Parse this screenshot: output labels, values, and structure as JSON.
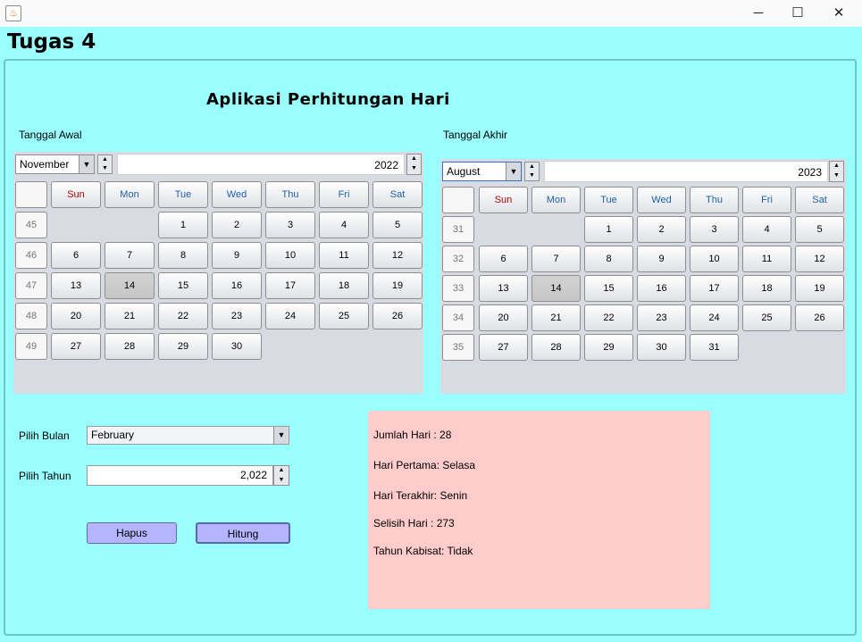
{
  "window": {
    "title_icon": "java-icon",
    "controls": {
      "minimize": "─",
      "maximize": "☐",
      "close": "✕"
    }
  },
  "frame_title": "Tugas 4",
  "app_heading": "Aplikasi Perhitungan Hari",
  "calendar_start": {
    "label": "Tanggal Awal",
    "month": "November",
    "year": "2022",
    "weekdays": [
      "Sun",
      "Mon",
      "Tue",
      "Wed",
      "Thu",
      "Fri",
      "Sat"
    ],
    "weeks": [
      "45",
      "46",
      "47",
      "48",
      "49"
    ],
    "first_weekday": 2,
    "days_in_month": 30,
    "selected_day": 14
  },
  "calendar_end": {
    "label": "Tanggal Akhir",
    "month": "August",
    "year": "2023",
    "weekdays": [
      "Sun",
      "Mon",
      "Tue",
      "Wed",
      "Thu",
      "Fri",
      "Sat"
    ],
    "weeks": [
      "31",
      "32",
      "33",
      "34",
      "35"
    ],
    "first_weekday": 2,
    "days_in_month": 31,
    "selected_day": 14
  },
  "form": {
    "month_label": "Pilih Bulan",
    "month_value": "February",
    "year_label": "Pilih Tahun",
    "year_value": "2,022",
    "clear_button": "Hapus",
    "compute_button": "Hitung"
  },
  "result": {
    "jumlah_hari": "Jumlah Hari : 28",
    "hari_pertama": "Hari Pertama: Selasa",
    "hari_terakhir": "Hari Terakhir: Senin",
    "selisih_hari": "Selisih Hari : 273",
    "tahun_kabisat": "Tahun Kabisat: Tidak"
  },
  "colors": {
    "frame_bg": "#99ffff",
    "result_bg": "#ffcccc",
    "button_bg": "#b4b4ff",
    "calendar_bg": "#d8dbe1"
  }
}
